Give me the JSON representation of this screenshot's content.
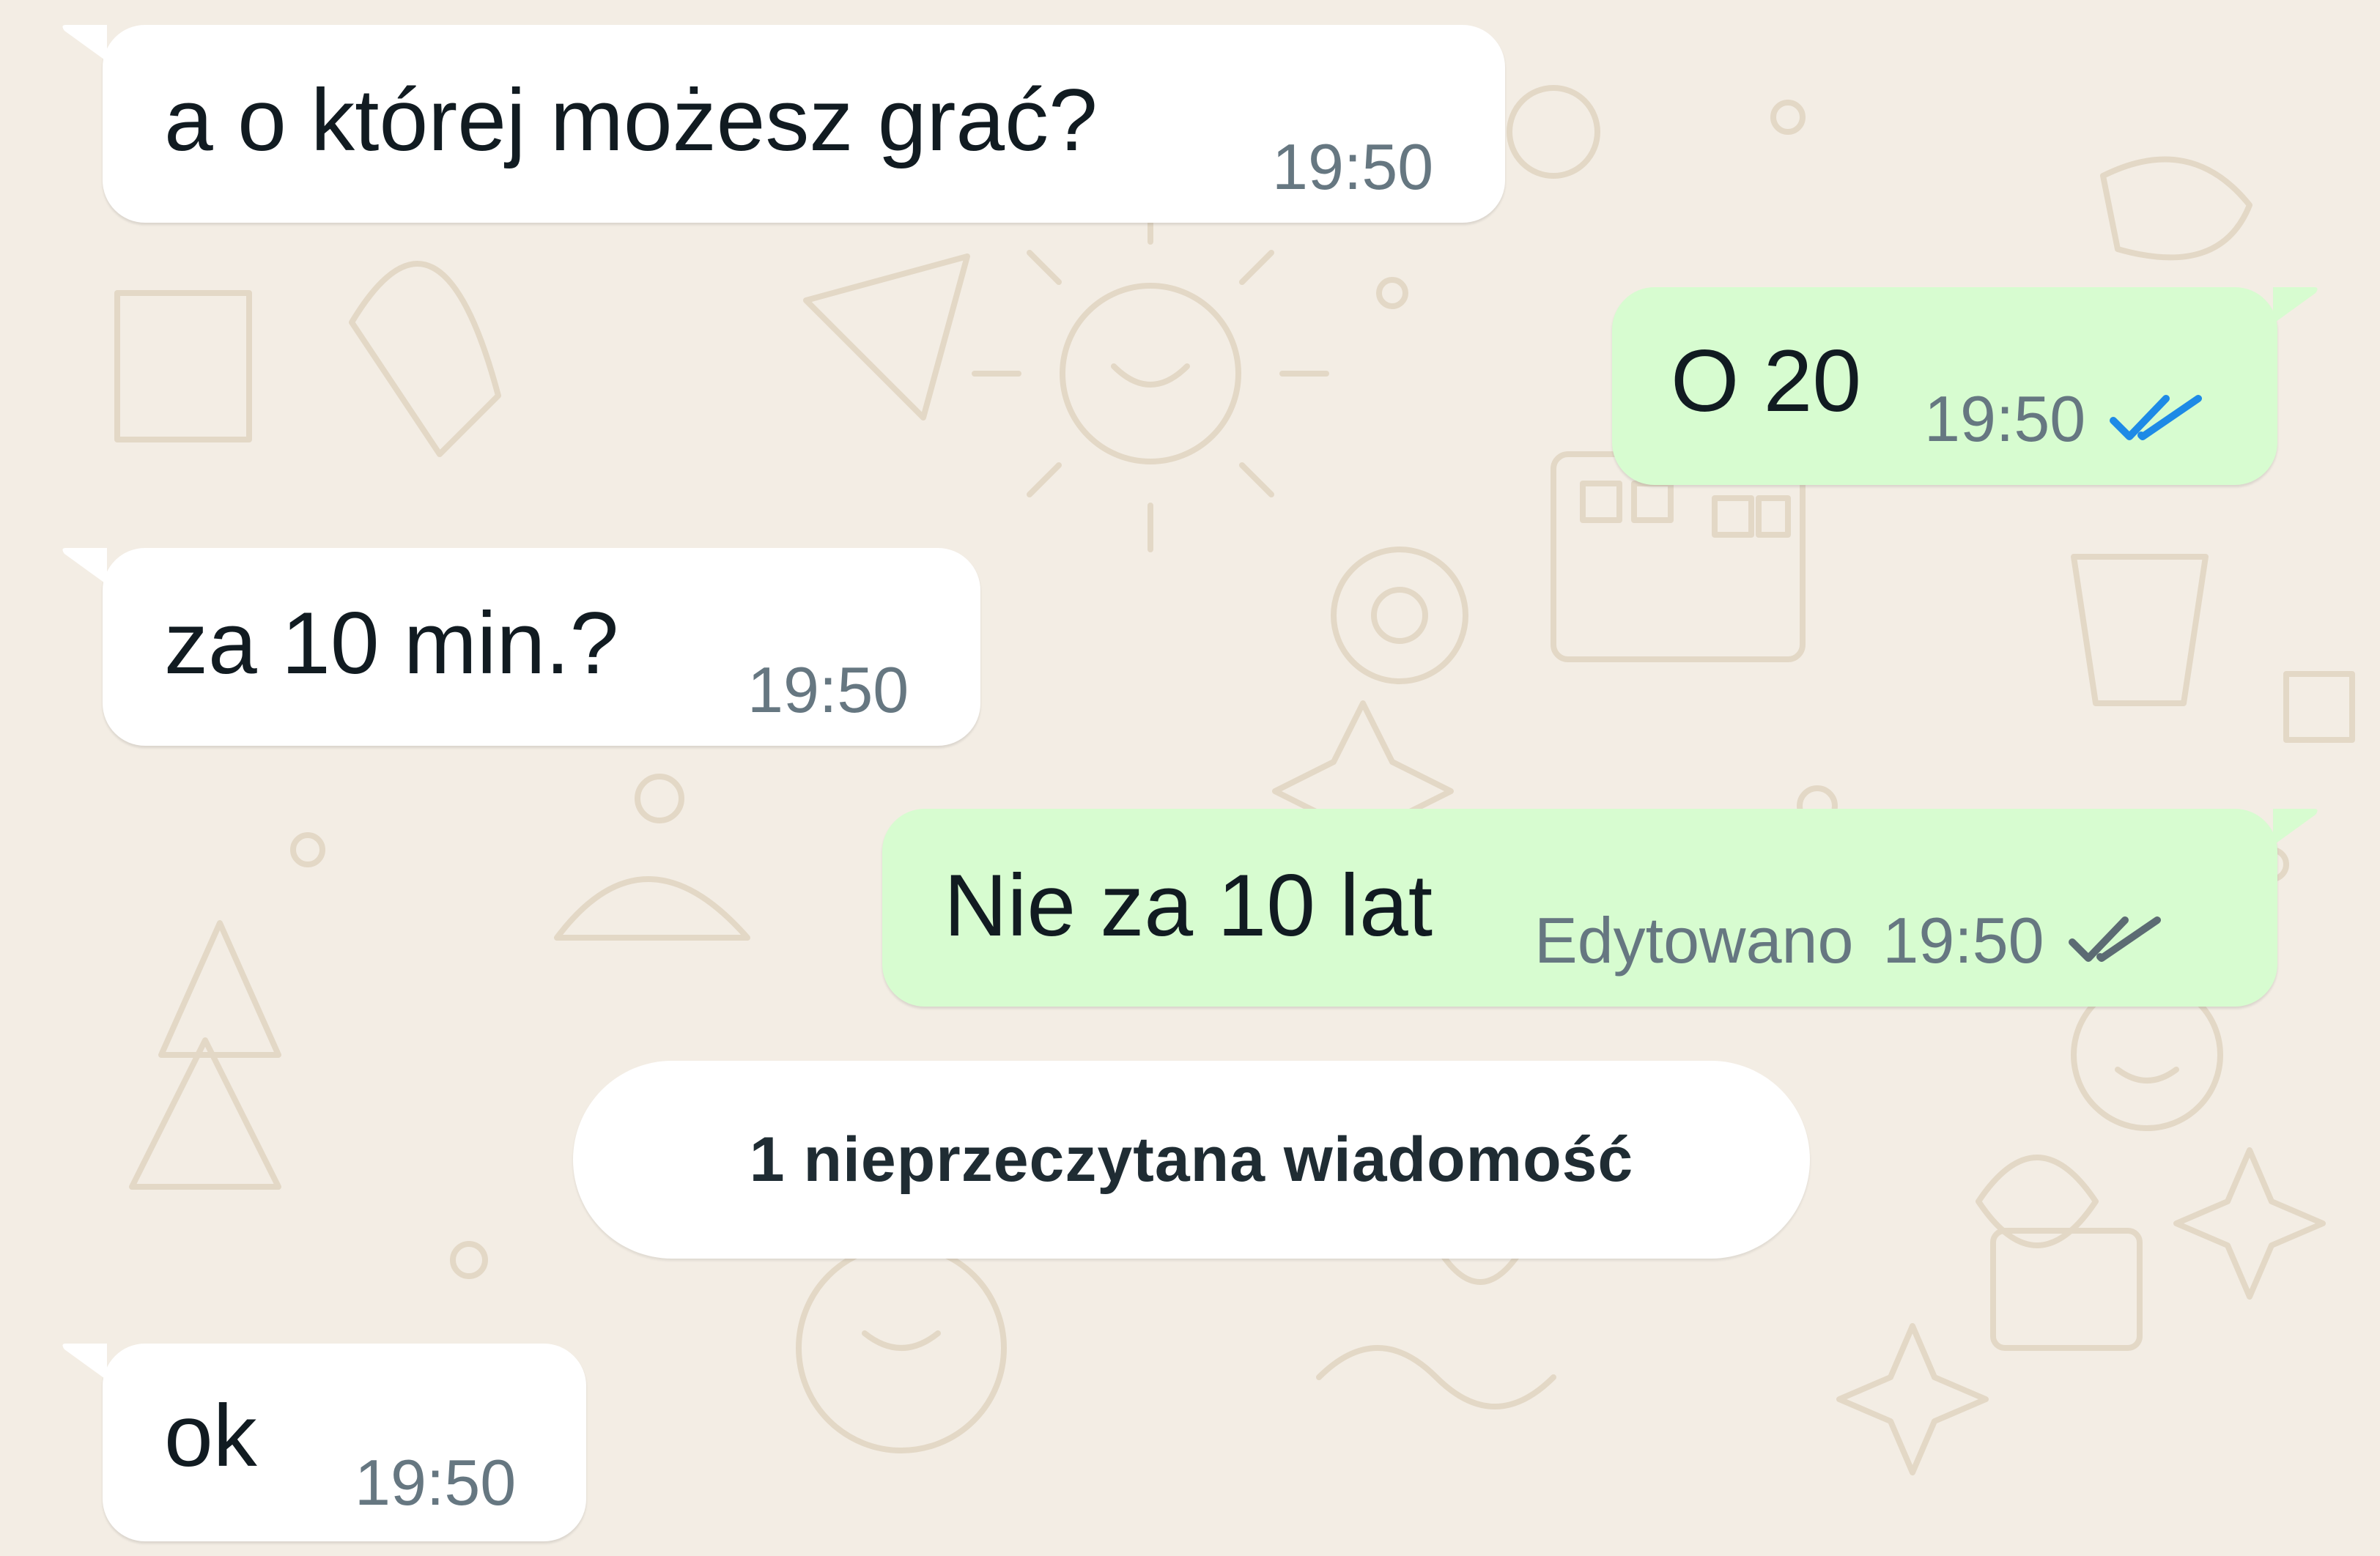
{
  "chat": {
    "messages": [
      {
        "direction": "incoming",
        "text": "a o której możesz grać?",
        "time": "19:50"
      },
      {
        "direction": "outgoing",
        "text": "O 20",
        "time": "19:50",
        "status": "read"
      },
      {
        "direction": "incoming",
        "text": "za 10 min.?",
        "time": "19:50"
      },
      {
        "direction": "outgoing",
        "text": "Nie za 10 lat",
        "edited_label": "Edytowano",
        "time": "19:50",
        "status": "delivered"
      },
      {
        "direction": "incoming",
        "text": "ok",
        "time": "19:50"
      }
    ],
    "unread_divider": "1 nieprzeczytana wiadomość"
  },
  "colors": {
    "wallpaper": "#f3ede4",
    "incoming_bubble": "#ffffff",
    "outgoing_bubble": "#d7fcd0",
    "read_ticks": "#1e8ae6",
    "delivered_ticks": "#5c6b73",
    "timestamp": "#667781",
    "message_text": "#111b21"
  }
}
